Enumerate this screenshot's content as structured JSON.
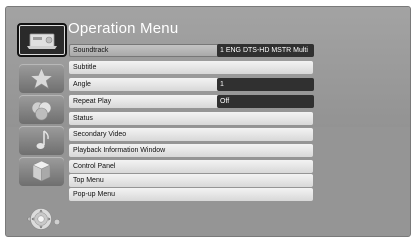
{
  "menu": {
    "title": "Operation Menu",
    "items": [
      {
        "label": "Soundtrack",
        "value": "1 ENG DTS-HD MSTR Multi"
      },
      {
        "label": "Subtitle",
        "value": null
      },
      {
        "label": "Angle",
        "value": "1"
      },
      {
        "label": "Repeat Play",
        "value": "Off"
      },
      {
        "label": "Status",
        "value": null
      },
      {
        "label": "Secondary Video",
        "value": null
      },
      {
        "label": "Playback Information Window",
        "value": null
      },
      {
        "label": "Control Panel",
        "value": null
      },
      {
        "label": "Top Menu",
        "value": null
      },
      {
        "label": "Pop-up Menu",
        "value": null
      }
    ]
  },
  "sidebar": {
    "icons": [
      "disc-player-icon",
      "star-icon",
      "circles-icon",
      "music-note-icon",
      "cube-icon"
    ],
    "selected_index": 0
  },
  "colors": {
    "background": "#959595",
    "value_box": "#303030",
    "row": "#e6e6e6",
    "title_text": "#ffffff"
  }
}
